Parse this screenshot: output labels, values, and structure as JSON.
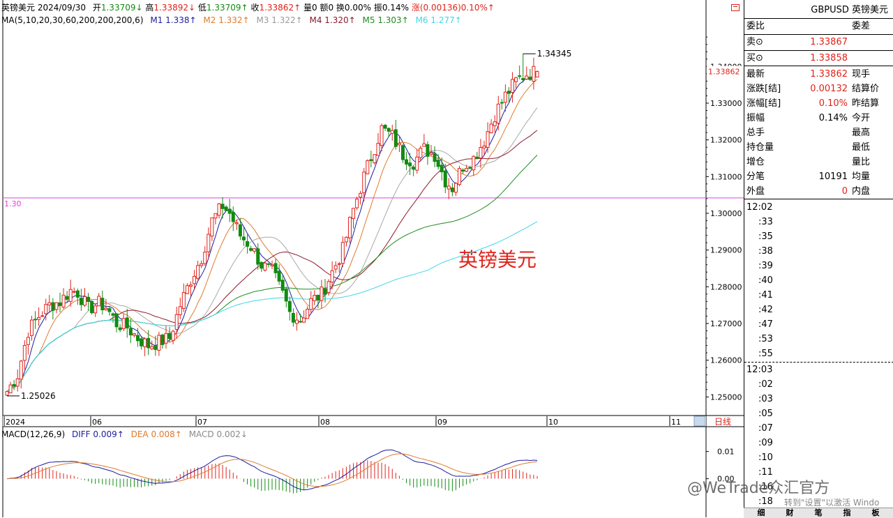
{
  "header": {
    "title": "英镑美元",
    "date": "2024/09/30",
    "open_label": "开",
    "open": "1.33709↓",
    "high_label": "高",
    "high": "1.33892↓",
    "low_label": "低",
    "low": "1.33709↑",
    "close_label": "收",
    "close": "1.33862↑",
    "volume": "量0",
    "amount": "额0",
    "turnover": "换0.00%",
    "amplitude": "振0.14%",
    "change": "涨(0.00136)0.10%↑"
  },
  "ma_header": {
    "label": "MA(5,10,20,30,60,200,200,200,6)",
    "items": [
      {
        "text": "M1 1.338↑",
        "color": "#1c1ca0"
      },
      {
        "text": "M2 1.332↑",
        "color": "#e07a2c"
      },
      {
        "text": "M3 1.322↑",
        "color": "#9a9a9a"
      },
      {
        "text": "M4 1.320↑",
        "color": "#8b1a2a"
      },
      {
        "text": "M5 1.303↑",
        "color": "#1e8c1e"
      },
      {
        "text": "M6 1.277↑",
        "color": "#3fd6e8"
      }
    ]
  },
  "macd_header": {
    "label": "MACD(12,26,9)",
    "diff": "DIFF 0.009↑",
    "dea": "DEA 0.008↑",
    "macd": "MACD 0.002↓"
  },
  "panel": {
    "symbol": "GBPUSD 英镑美元",
    "weibi": "委比",
    "weicha": "委差",
    "sell_label": "卖⊙",
    "sell": "1.33867",
    "buy_label": "买⊙",
    "buy": "1.33858",
    "rows": [
      {
        "l1": "最新",
        "v1": "1.33862",
        "c1": "#e0221a",
        "l2": "现手"
      },
      {
        "l1": "涨跌[结]",
        "v1": "0.00132",
        "c1": "#e0221a",
        "l2": "结算价"
      },
      {
        "l1": "涨幅[结]",
        "v1": "0.10%",
        "c1": "#e0221a",
        "l2": "昨结算"
      },
      {
        "l1": "振幅",
        "v1": "0.14%",
        "c1": "#000000",
        "l2": "今开"
      },
      {
        "l1": "总手",
        "v1": "",
        "c1": "#000000",
        "l2": "最高"
      },
      {
        "l1": "持仓量",
        "v1": "",
        "c1": "#000000",
        "l2": "最低"
      },
      {
        "l1": "增仓",
        "v1": "",
        "c1": "#000000",
        "l2": "量比"
      },
      {
        "l1": "分笔",
        "v1": "10191",
        "c1": "#000000",
        "l2": "均量"
      },
      {
        "l1": "外盘",
        "v1": "0",
        "c1": "#e0221a",
        "l2": "内盘"
      }
    ],
    "ticks1": [
      "12:02",
      ":33",
      ":35",
      ":38",
      ":39",
      ":40",
      ":41",
      ":42",
      ":47",
      ":53",
      ":55"
    ],
    "ticks2": [
      "12:03",
      ":02",
      ":03",
      ":05",
      ":07",
      ":09",
      ":10",
      ":11",
      ":16",
      ":18"
    ],
    "tabs": [
      "细",
      "财",
      "笔",
      "指",
      "板"
    ]
  },
  "watermark": "@WeTrade众汇官方",
  "activate_text": "转到\"设置\"以激活 Windo",
  "timeframe": "日线",
  "chart_data": {
    "type": "candlestick",
    "title": "英镑美元",
    "y_ticks": [
      "1.25000",
      "1.26000",
      "1.27000",
      "1.28000",
      "1.29000",
      "1.30000",
      "1.31000",
      "1.32000",
      "1.33000",
      "1.34000"
    ],
    "ylim": [
      1.2455,
      1.3505
    ],
    "current_price": "1.33862",
    "x_labels": [
      "2024",
      "06",
      "07",
      "08",
      "09",
      "10",
      "11"
    ],
    "horizontal_line": {
      "value": 1.3042,
      "label": "1.30",
      "color": "#e040e0"
    },
    "annotations": [
      {
        "text": "1.34345",
        "value": 1.34345,
        "type": "high"
      },
      {
        "text": "1.25026",
        "value": 1.25026,
        "type": "low"
      }
    ],
    "overlay_text": "英镑美元",
    "anchors": [
      [
        0,
        1.2515
      ],
      [
        3,
        1.256
      ],
      [
        6,
        1.268
      ],
      [
        9,
        1.272
      ],
      [
        12,
        1.275
      ],
      [
        15,
        1.276
      ],
      [
        18,
        1.279
      ],
      [
        20,
        1.2785
      ],
      [
        23,
        1.274
      ],
      [
        26,
        1.2755
      ],
      [
        28,
        1.2745
      ],
      [
        31,
        1.27
      ],
      [
        34,
        1.269
      ],
      [
        37,
        1.266
      ],
      [
        40,
        1.264
      ],
      [
        43,
        1.265
      ],
      [
        46,
        1.266
      ],
      [
        49,
        1.275
      ],
      [
        52,
        1.282
      ],
      [
        55,
        1.288
      ],
      [
        58,
        1.298
      ],
      [
        61,
        1.302
      ],
      [
        63,
        1.3
      ],
      [
        66,
        1.294
      ],
      [
        69,
        1.291
      ],
      [
        72,
        1.286
      ],
      [
        75,
        1.284
      ],
      [
        78,
        1.278
      ],
      [
        80,
        1.273
      ],
      [
        83,
        1.271
      ],
      [
        86,
        1.276
      ],
      [
        89,
        1.278
      ],
      [
        92,
        1.284
      ],
      [
        95,
        1.29
      ],
      [
        98,
        1.301
      ],
      [
        101,
        1.31
      ],
      [
        104,
        1.318
      ],
      [
        106,
        1.323
      ],
      [
        109,
        1.321
      ],
      [
        112,
        1.316
      ],
      [
        115,
        1.314
      ],
      [
        118,
        1.3175
      ],
      [
        121,
        1.316
      ],
      [
        124,
        1.309
      ],
      [
        126,
        1.307
      ],
      [
        129,
        1.313
      ],
      [
        132,
        1.315
      ],
      [
        135,
        1.32
      ],
      [
        138,
        1.327
      ],
      [
        141,
        1.332
      ],
      [
        144,
        1.336
      ],
      [
        147,
        1.338
      ],
      [
        150,
        1.3386
      ]
    ],
    "ma_lines": [
      {
        "name": "M1",
        "color": "#1c1ca0",
        "period": 5
      },
      {
        "name": "M2",
        "color": "#e07a2c",
        "period": 10
      },
      {
        "name": "M3",
        "color": "#a8a8a8",
        "period": 20
      },
      {
        "name": "M4",
        "color": "#8b1a2a",
        "period": 30
      },
      {
        "name": "M5",
        "color": "#1e8c1e",
        "period": 60
      },
      {
        "name": "M6",
        "color": "#3fd6e8",
        "period": 120
      }
    ],
    "macd": {
      "y_ticks": [
        "0.01",
        "0.00"
      ],
      "ylim": [
        -0.0142,
        0.014
      ]
    },
    "colors": {
      "up": "#e0221a",
      "down": "#128a12"
    }
  }
}
